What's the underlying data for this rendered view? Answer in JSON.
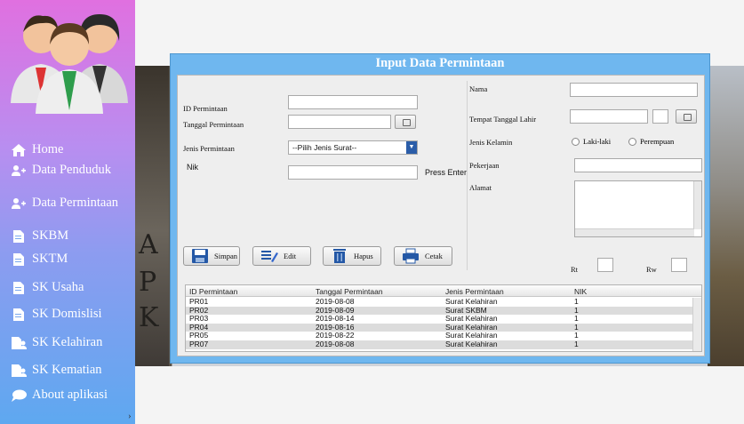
{
  "sidebar": {
    "items": [
      {
        "label": "Home",
        "icon": "home-icon"
      },
      {
        "label": "Data Penduduk",
        "icon": "people-plus-icon"
      },
      {
        "label": "Data Permintaan",
        "icon": "people-plus-icon"
      },
      {
        "label": "SKBM",
        "icon": "document-icon"
      },
      {
        "label": "SKTM",
        "icon": "document-icon"
      },
      {
        "label": "SK Usaha",
        "icon": "document-icon"
      },
      {
        "label": "SK Domislisi",
        "icon": "document-icon"
      },
      {
        "label": "SK Kelahiran",
        "icon": "document-person-icon"
      },
      {
        "label": "SK Kematian",
        "icon": "document-person-icon"
      },
      {
        "label": "About aplikasi",
        "icon": "chat-bubble-icon"
      }
    ],
    "collapse_glyph": "›"
  },
  "background": {
    "letters": [
      "A",
      "P",
      "K"
    ]
  },
  "dialog": {
    "title": "Input Data Permintaan",
    "labels": {
      "id_permintaan": "ID Permintaan",
      "tanggal_permintaan": "Tanggal Permintaan",
      "jenis_permintaan": "Jenis Permintaan",
      "nik": "Nik",
      "press_enter": "Press Enter",
      "nama": "Nama",
      "tempat_tanggal_lahir": "Tempat Tanggal Lahir",
      "jenis_kelamin": "Jenis Kelamin",
      "pekerjaan": "Pekerjaan",
      "alamat": "Alamat",
      "rt": "Rt",
      "rw": "Rw"
    },
    "select_value": "--Pilih Jenis Surat--",
    "radio": {
      "male": "Laki-laki",
      "female": "Perempuan"
    },
    "buttons": {
      "save": "Simpan",
      "edit": "Edit",
      "delete": "Hapus",
      "print": "Cetak"
    },
    "table": {
      "columns": [
        "ID Permintaan",
        "Tanggal Permintaan",
        "Jenis Permintaan",
        "NIK"
      ],
      "rows": [
        [
          "PR01",
          "2019-08-08",
          "Surat Kelahiran",
          "1"
        ],
        [
          "PR02",
          "2019-08-09",
          "Surat SKBM",
          "1"
        ],
        [
          "PR03",
          "2019-08-14",
          "Surat Kelahiran",
          "1"
        ],
        [
          "PR04",
          "2019-08-16",
          "Surat Kelahiran",
          "1"
        ],
        [
          "PR05",
          "2019-08-22",
          "Surat Kelahiran",
          "1"
        ],
        [
          "PR07",
          "2019-08-08",
          "Surat Kelahiran",
          "1"
        ]
      ]
    }
  },
  "colors": {
    "dialog_header": "#6fb7ef",
    "sidebar_top": "#e070e0",
    "sidebar_bottom": "#5ea8f0"
  }
}
